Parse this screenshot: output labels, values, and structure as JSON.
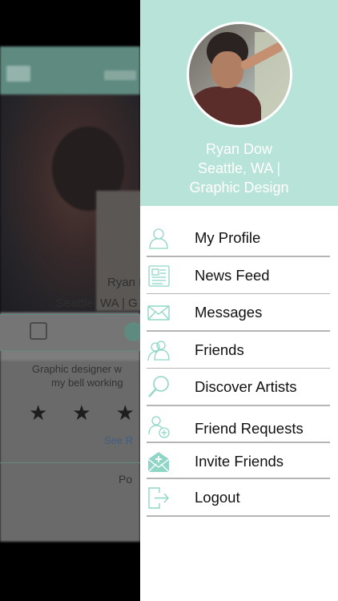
{
  "profile": {
    "name": "Ryan Dow",
    "location_line": "Seattle, WA |",
    "specialty_line": "Graphic Design"
  },
  "menu": {
    "items": [
      {
        "label": "My Profile",
        "icon": "user-icon"
      },
      {
        "label": "News Feed",
        "icon": "newspaper-icon"
      },
      {
        "label": "Messages",
        "icon": "envelope-icon"
      },
      {
        "label": "Friends",
        "icon": "friends-icon"
      },
      {
        "label": "Discover Artists",
        "icon": "search-icon"
      },
      {
        "label": "Friend Requests",
        "icon": "add-friend-icon"
      },
      {
        "label": "Invite Friends",
        "icon": "invite-mail-icon"
      },
      {
        "label": "Logout",
        "icon": "logout-icon"
      }
    ]
  },
  "background": {
    "name": "Ryan I",
    "location": "Seattle, WA | G",
    "bio_line1": "Graphic designer w",
    "bio_line2": "my bell working",
    "stars": "★★★",
    "see_more": "See R",
    "post": "Po"
  },
  "colors": {
    "accent": "#b7e3d8",
    "icon": "#8fd6c6",
    "separator": "#b5b5b5"
  }
}
